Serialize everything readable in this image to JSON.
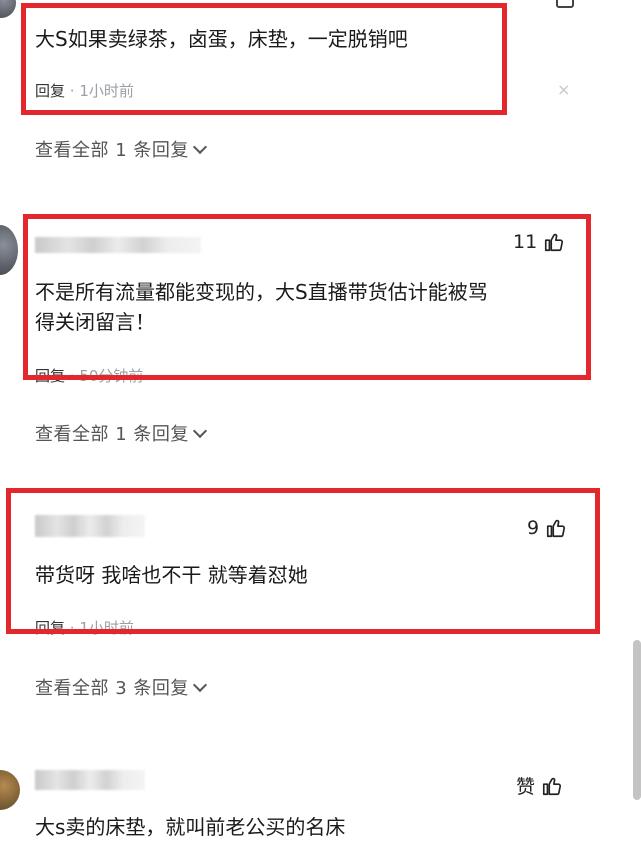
{
  "comments": [
    {
      "text": "大S如果卖绿茶，卤蛋，床垫，一定脱销吧",
      "reply_label": "回复",
      "time": "1小时前",
      "close": "×",
      "view_all": "查看全部 1 条回复"
    },
    {
      "likes": "11",
      "text_line1": "不是所有流量都能变现的，大S直播带货估计能被骂",
      "text_line2": "得关闭留言！",
      "reply_label": "回复",
      "time": "50分钟前",
      "view_all": "查看全部 1 条回复"
    },
    {
      "likes": "9",
      "text": "带货呀 我啥也不干 就等着怼她",
      "reply_label": "回复",
      "time": "1小时前",
      "view_all": "查看全部 3 条回复"
    },
    {
      "likes": "赞",
      "text": "大s卖的床垫，就叫前老公买的名床"
    }
  ],
  "colors": {
    "highlight": "#e2282d",
    "meta_gray": "#9aa0a6"
  },
  "icons": [
    "thumbs-up-icon",
    "chevron-down-icon",
    "close-icon"
  ]
}
